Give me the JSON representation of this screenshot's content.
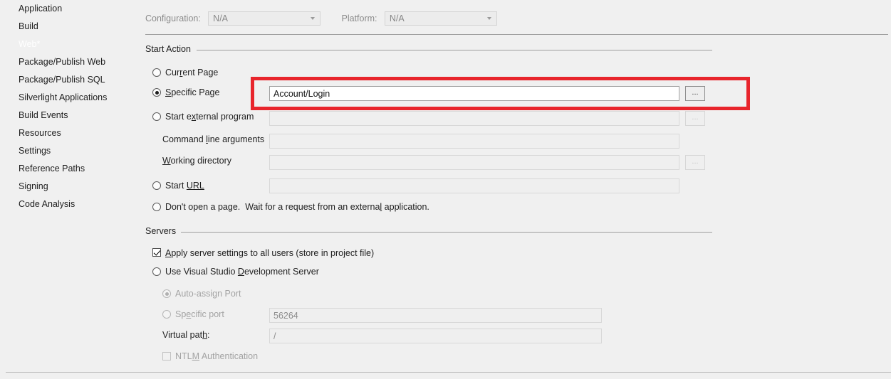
{
  "sidebar": {
    "items": [
      {
        "label": "Application",
        "selected": false
      },
      {
        "label": "Build",
        "selected": false
      },
      {
        "label": "Web*",
        "selected": true
      },
      {
        "label": "Package/Publish Web",
        "selected": false
      },
      {
        "label": "Package/Publish SQL",
        "selected": false
      },
      {
        "label": "Silverlight Applications",
        "selected": false
      },
      {
        "label": "Build Events",
        "selected": false
      },
      {
        "label": "Resources",
        "selected": false
      },
      {
        "label": "Settings",
        "selected": false
      },
      {
        "label": "Reference Paths",
        "selected": false
      },
      {
        "label": "Signing",
        "selected": false
      },
      {
        "label": "Code Analysis",
        "selected": false
      }
    ]
  },
  "header": {
    "configuration_label": "Configuration:",
    "configuration_value": "N/A",
    "platform_label": "Platform:",
    "platform_value": "N/A"
  },
  "start_action": {
    "group_label": "Start Action",
    "current_page_label": "Current Page",
    "specific_page_label": "Specific Page",
    "specific_page_value": "Account/Login",
    "start_external_program_label": "Start external program",
    "start_external_program_value": "",
    "command_line_arguments_label": "Command line arguments",
    "command_line_arguments_value": "",
    "working_directory_label": "Working directory",
    "working_directory_value": "",
    "start_url_label": "Start URL",
    "start_url_value": "",
    "dont_open_page_label": "Don't open a page.  Wait for a request from an external application.",
    "browse_label": "..."
  },
  "servers": {
    "group_label": "Servers",
    "apply_server_settings_label": "Apply server settings to all users (store in project file)",
    "use_vs_dev_server_label": "Use Visual Studio Development Server",
    "auto_assign_port_label": "Auto-assign Port",
    "specific_port_label": "Specific port",
    "specific_port_value": "56264",
    "virtual_path_label": "Virtual path:",
    "virtual_path_value": "/",
    "ntlm_authentication_label": "NTLM Authentication"
  },
  "colors": {
    "selection_blue": "#3799f5",
    "annotation_red": "#e8252c",
    "background": "#f0f0f0"
  }
}
